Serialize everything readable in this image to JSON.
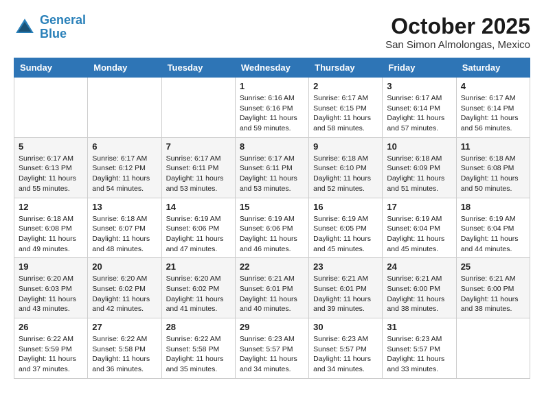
{
  "header": {
    "logo_line1": "General",
    "logo_line2": "Blue",
    "month": "October 2025",
    "location": "San Simon Almolongas, Mexico"
  },
  "days_of_week": [
    "Sunday",
    "Monday",
    "Tuesday",
    "Wednesday",
    "Thursday",
    "Friday",
    "Saturday"
  ],
  "weeks": [
    [
      {
        "day": "",
        "info": ""
      },
      {
        "day": "",
        "info": ""
      },
      {
        "day": "",
        "info": ""
      },
      {
        "day": "1",
        "info": "Sunrise: 6:16 AM\nSunset: 6:16 PM\nDaylight: 11 hours\nand 59 minutes."
      },
      {
        "day": "2",
        "info": "Sunrise: 6:17 AM\nSunset: 6:15 PM\nDaylight: 11 hours\nand 58 minutes."
      },
      {
        "day": "3",
        "info": "Sunrise: 6:17 AM\nSunset: 6:14 PM\nDaylight: 11 hours\nand 57 minutes."
      },
      {
        "day": "4",
        "info": "Sunrise: 6:17 AM\nSunset: 6:14 PM\nDaylight: 11 hours\nand 56 minutes."
      }
    ],
    [
      {
        "day": "5",
        "info": "Sunrise: 6:17 AM\nSunset: 6:13 PM\nDaylight: 11 hours\nand 55 minutes."
      },
      {
        "day": "6",
        "info": "Sunrise: 6:17 AM\nSunset: 6:12 PM\nDaylight: 11 hours\nand 54 minutes."
      },
      {
        "day": "7",
        "info": "Sunrise: 6:17 AM\nSunset: 6:11 PM\nDaylight: 11 hours\nand 53 minutes."
      },
      {
        "day": "8",
        "info": "Sunrise: 6:17 AM\nSunset: 6:11 PM\nDaylight: 11 hours\nand 53 minutes."
      },
      {
        "day": "9",
        "info": "Sunrise: 6:18 AM\nSunset: 6:10 PM\nDaylight: 11 hours\nand 52 minutes."
      },
      {
        "day": "10",
        "info": "Sunrise: 6:18 AM\nSunset: 6:09 PM\nDaylight: 11 hours\nand 51 minutes."
      },
      {
        "day": "11",
        "info": "Sunrise: 6:18 AM\nSunset: 6:08 PM\nDaylight: 11 hours\nand 50 minutes."
      }
    ],
    [
      {
        "day": "12",
        "info": "Sunrise: 6:18 AM\nSunset: 6:08 PM\nDaylight: 11 hours\nand 49 minutes."
      },
      {
        "day": "13",
        "info": "Sunrise: 6:18 AM\nSunset: 6:07 PM\nDaylight: 11 hours\nand 48 minutes."
      },
      {
        "day": "14",
        "info": "Sunrise: 6:19 AM\nSunset: 6:06 PM\nDaylight: 11 hours\nand 47 minutes."
      },
      {
        "day": "15",
        "info": "Sunrise: 6:19 AM\nSunset: 6:06 PM\nDaylight: 11 hours\nand 46 minutes."
      },
      {
        "day": "16",
        "info": "Sunrise: 6:19 AM\nSunset: 6:05 PM\nDaylight: 11 hours\nand 45 minutes."
      },
      {
        "day": "17",
        "info": "Sunrise: 6:19 AM\nSunset: 6:04 PM\nDaylight: 11 hours\nand 45 minutes."
      },
      {
        "day": "18",
        "info": "Sunrise: 6:19 AM\nSunset: 6:04 PM\nDaylight: 11 hours\nand 44 minutes."
      }
    ],
    [
      {
        "day": "19",
        "info": "Sunrise: 6:20 AM\nSunset: 6:03 PM\nDaylight: 11 hours\nand 43 minutes."
      },
      {
        "day": "20",
        "info": "Sunrise: 6:20 AM\nSunset: 6:02 PM\nDaylight: 11 hours\nand 42 minutes."
      },
      {
        "day": "21",
        "info": "Sunrise: 6:20 AM\nSunset: 6:02 PM\nDaylight: 11 hours\nand 41 minutes."
      },
      {
        "day": "22",
        "info": "Sunrise: 6:21 AM\nSunset: 6:01 PM\nDaylight: 11 hours\nand 40 minutes."
      },
      {
        "day": "23",
        "info": "Sunrise: 6:21 AM\nSunset: 6:01 PM\nDaylight: 11 hours\nand 39 minutes."
      },
      {
        "day": "24",
        "info": "Sunrise: 6:21 AM\nSunset: 6:00 PM\nDaylight: 11 hours\nand 38 minutes."
      },
      {
        "day": "25",
        "info": "Sunrise: 6:21 AM\nSunset: 6:00 PM\nDaylight: 11 hours\nand 38 minutes."
      }
    ],
    [
      {
        "day": "26",
        "info": "Sunrise: 6:22 AM\nSunset: 5:59 PM\nDaylight: 11 hours\nand 37 minutes."
      },
      {
        "day": "27",
        "info": "Sunrise: 6:22 AM\nSunset: 5:58 PM\nDaylight: 11 hours\nand 36 minutes."
      },
      {
        "day": "28",
        "info": "Sunrise: 6:22 AM\nSunset: 5:58 PM\nDaylight: 11 hours\nand 35 minutes."
      },
      {
        "day": "29",
        "info": "Sunrise: 6:23 AM\nSunset: 5:57 PM\nDaylight: 11 hours\nand 34 minutes."
      },
      {
        "day": "30",
        "info": "Sunrise: 6:23 AM\nSunset: 5:57 PM\nDaylight: 11 hours\nand 34 minutes."
      },
      {
        "day": "31",
        "info": "Sunrise: 6:23 AM\nSunset: 5:57 PM\nDaylight: 11 hours\nand 33 minutes."
      },
      {
        "day": "",
        "info": ""
      }
    ]
  ]
}
